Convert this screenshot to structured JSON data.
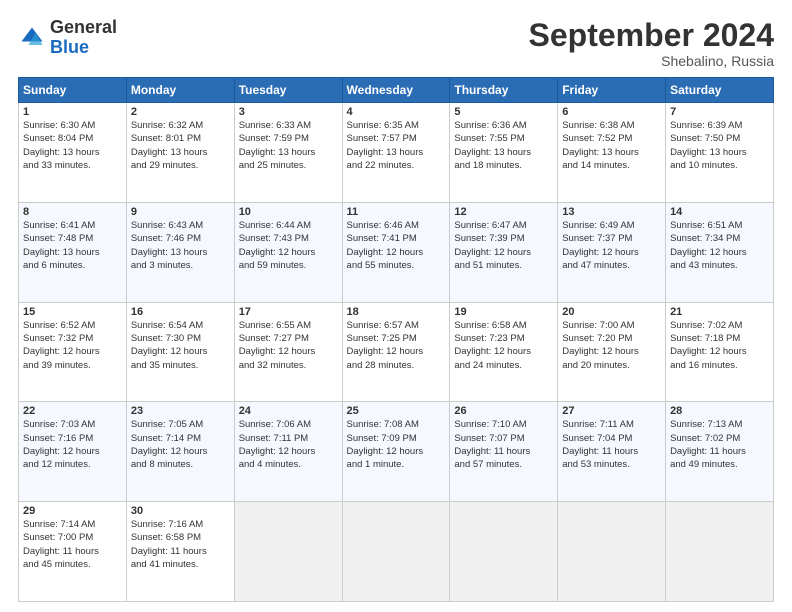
{
  "logo": {
    "general": "General",
    "blue": "Blue"
  },
  "header": {
    "month": "September 2024",
    "location": "Shebalino, Russia"
  },
  "weekdays": [
    "Sunday",
    "Monday",
    "Tuesday",
    "Wednesday",
    "Thursday",
    "Friday",
    "Saturday"
  ],
  "weeks": [
    [
      {
        "day": "1",
        "info": "Sunrise: 6:30 AM\nSunset: 8:04 PM\nDaylight: 13 hours\nand 33 minutes."
      },
      {
        "day": "2",
        "info": "Sunrise: 6:32 AM\nSunset: 8:01 PM\nDaylight: 13 hours\nand 29 minutes."
      },
      {
        "day": "3",
        "info": "Sunrise: 6:33 AM\nSunset: 7:59 PM\nDaylight: 13 hours\nand 25 minutes."
      },
      {
        "day": "4",
        "info": "Sunrise: 6:35 AM\nSunset: 7:57 PM\nDaylight: 13 hours\nand 22 minutes."
      },
      {
        "day": "5",
        "info": "Sunrise: 6:36 AM\nSunset: 7:55 PM\nDaylight: 13 hours\nand 18 minutes."
      },
      {
        "day": "6",
        "info": "Sunrise: 6:38 AM\nSunset: 7:52 PM\nDaylight: 13 hours\nand 14 minutes."
      },
      {
        "day": "7",
        "info": "Sunrise: 6:39 AM\nSunset: 7:50 PM\nDaylight: 13 hours\nand 10 minutes."
      }
    ],
    [
      {
        "day": "8",
        "info": "Sunrise: 6:41 AM\nSunset: 7:48 PM\nDaylight: 13 hours\nand 6 minutes."
      },
      {
        "day": "9",
        "info": "Sunrise: 6:43 AM\nSunset: 7:46 PM\nDaylight: 13 hours\nand 3 minutes."
      },
      {
        "day": "10",
        "info": "Sunrise: 6:44 AM\nSunset: 7:43 PM\nDaylight: 12 hours\nand 59 minutes."
      },
      {
        "day": "11",
        "info": "Sunrise: 6:46 AM\nSunset: 7:41 PM\nDaylight: 12 hours\nand 55 minutes."
      },
      {
        "day": "12",
        "info": "Sunrise: 6:47 AM\nSunset: 7:39 PM\nDaylight: 12 hours\nand 51 minutes."
      },
      {
        "day": "13",
        "info": "Sunrise: 6:49 AM\nSunset: 7:37 PM\nDaylight: 12 hours\nand 47 minutes."
      },
      {
        "day": "14",
        "info": "Sunrise: 6:51 AM\nSunset: 7:34 PM\nDaylight: 12 hours\nand 43 minutes."
      }
    ],
    [
      {
        "day": "15",
        "info": "Sunrise: 6:52 AM\nSunset: 7:32 PM\nDaylight: 12 hours\nand 39 minutes."
      },
      {
        "day": "16",
        "info": "Sunrise: 6:54 AM\nSunset: 7:30 PM\nDaylight: 12 hours\nand 35 minutes."
      },
      {
        "day": "17",
        "info": "Sunrise: 6:55 AM\nSunset: 7:27 PM\nDaylight: 12 hours\nand 32 minutes."
      },
      {
        "day": "18",
        "info": "Sunrise: 6:57 AM\nSunset: 7:25 PM\nDaylight: 12 hours\nand 28 minutes."
      },
      {
        "day": "19",
        "info": "Sunrise: 6:58 AM\nSunset: 7:23 PM\nDaylight: 12 hours\nand 24 minutes."
      },
      {
        "day": "20",
        "info": "Sunrise: 7:00 AM\nSunset: 7:20 PM\nDaylight: 12 hours\nand 20 minutes."
      },
      {
        "day": "21",
        "info": "Sunrise: 7:02 AM\nSunset: 7:18 PM\nDaylight: 12 hours\nand 16 minutes."
      }
    ],
    [
      {
        "day": "22",
        "info": "Sunrise: 7:03 AM\nSunset: 7:16 PM\nDaylight: 12 hours\nand 12 minutes."
      },
      {
        "day": "23",
        "info": "Sunrise: 7:05 AM\nSunset: 7:14 PM\nDaylight: 12 hours\nand 8 minutes."
      },
      {
        "day": "24",
        "info": "Sunrise: 7:06 AM\nSunset: 7:11 PM\nDaylight: 12 hours\nand 4 minutes."
      },
      {
        "day": "25",
        "info": "Sunrise: 7:08 AM\nSunset: 7:09 PM\nDaylight: 12 hours\nand 1 minute."
      },
      {
        "day": "26",
        "info": "Sunrise: 7:10 AM\nSunset: 7:07 PM\nDaylight: 11 hours\nand 57 minutes."
      },
      {
        "day": "27",
        "info": "Sunrise: 7:11 AM\nSunset: 7:04 PM\nDaylight: 11 hours\nand 53 minutes."
      },
      {
        "day": "28",
        "info": "Sunrise: 7:13 AM\nSunset: 7:02 PM\nDaylight: 11 hours\nand 49 minutes."
      }
    ],
    [
      {
        "day": "29",
        "info": "Sunrise: 7:14 AM\nSunset: 7:00 PM\nDaylight: 11 hours\nand 45 minutes."
      },
      {
        "day": "30",
        "info": "Sunrise: 7:16 AM\nSunset: 6:58 PM\nDaylight: 11 hours\nand 41 minutes."
      },
      {
        "day": "",
        "info": ""
      },
      {
        "day": "",
        "info": ""
      },
      {
        "day": "",
        "info": ""
      },
      {
        "day": "",
        "info": ""
      },
      {
        "day": "",
        "info": ""
      }
    ]
  ]
}
